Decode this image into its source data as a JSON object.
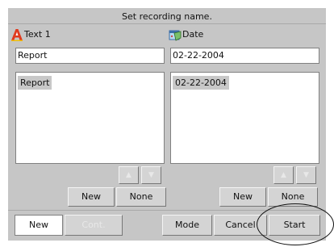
{
  "dialog": {
    "title": "Set recording name."
  },
  "left": {
    "header_icon": "text-a-icon",
    "header_label": "Text 1",
    "field_value": "Report",
    "list_selected": "Report",
    "new_label": "New",
    "none_label": "None"
  },
  "right": {
    "header_icon": "calendar-date-icon",
    "header_label": "Date",
    "field_value": "02-22-2004",
    "list_selected": "02-22-2004",
    "new_label": "New",
    "none_label": "None"
  },
  "arrows": {
    "up": "▲",
    "down": "▼"
  },
  "bottom": {
    "new_label": "New",
    "cont_label": "Cont.",
    "mode_label": "Mode",
    "cancel_label": "Cancel",
    "start_label": "Start"
  },
  "colors": {
    "panel": "#c6c6c6",
    "icon_a": "#e03a1e",
    "highlight": "#c8c8c8"
  }
}
